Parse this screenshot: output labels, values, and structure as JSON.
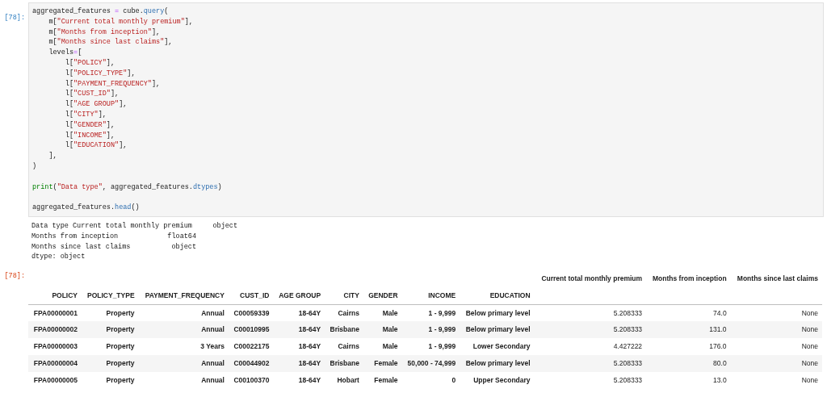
{
  "input_cell": {
    "prompt": "[78]:",
    "lines": [
      [
        {
          "kind": "plain",
          "text": "aggregated_features "
        },
        {
          "kind": "op",
          "text": "="
        },
        {
          "kind": "plain",
          "text": " cube."
        },
        {
          "kind": "method",
          "text": "query"
        },
        {
          "kind": "plain",
          "text": "("
        }
      ],
      [
        {
          "kind": "plain",
          "text": "    m["
        },
        {
          "kind": "string",
          "text": "\"Current total monthly premium\""
        },
        {
          "kind": "plain",
          "text": "],"
        }
      ],
      [
        {
          "kind": "plain",
          "text": "    m["
        },
        {
          "kind": "string",
          "text": "\"Months from inception\""
        },
        {
          "kind": "plain",
          "text": "],"
        }
      ],
      [
        {
          "kind": "plain",
          "text": "    m["
        },
        {
          "kind": "string",
          "text": "\"Months since last claims\""
        },
        {
          "kind": "plain",
          "text": "],"
        }
      ],
      [
        {
          "kind": "plain",
          "text": "    levels"
        },
        {
          "kind": "op",
          "text": "="
        },
        {
          "kind": "plain",
          "text": "["
        }
      ],
      [
        {
          "kind": "plain",
          "text": "        l["
        },
        {
          "kind": "string",
          "text": "\"POLICY\""
        },
        {
          "kind": "plain",
          "text": "],"
        }
      ],
      [
        {
          "kind": "plain",
          "text": "        l["
        },
        {
          "kind": "string",
          "text": "\"POLICY_TYPE\""
        },
        {
          "kind": "plain",
          "text": "],"
        }
      ],
      [
        {
          "kind": "plain",
          "text": "        l["
        },
        {
          "kind": "string",
          "text": "\"PAYMENT_FREQUENCY\""
        },
        {
          "kind": "plain",
          "text": "],"
        }
      ],
      [
        {
          "kind": "plain",
          "text": "        l["
        },
        {
          "kind": "string",
          "text": "\"CUST_ID\""
        },
        {
          "kind": "plain",
          "text": "],"
        }
      ],
      [
        {
          "kind": "plain",
          "text": "        l["
        },
        {
          "kind": "string",
          "text": "\"AGE GROUP\""
        },
        {
          "kind": "plain",
          "text": "],"
        }
      ],
      [
        {
          "kind": "plain",
          "text": "        l["
        },
        {
          "kind": "string",
          "text": "\"CITY\""
        },
        {
          "kind": "plain",
          "text": "],"
        }
      ],
      [
        {
          "kind": "plain",
          "text": "        l["
        },
        {
          "kind": "string",
          "text": "\"GENDER\""
        },
        {
          "kind": "plain",
          "text": "],"
        }
      ],
      [
        {
          "kind": "plain",
          "text": "        l["
        },
        {
          "kind": "string",
          "text": "\"INCOME\""
        },
        {
          "kind": "plain",
          "text": "],"
        }
      ],
      [
        {
          "kind": "plain",
          "text": "        l["
        },
        {
          "kind": "string",
          "text": "\"EDUCATION\""
        },
        {
          "kind": "plain",
          "text": "],"
        }
      ],
      [
        {
          "kind": "plain",
          "text": "    ],"
        }
      ],
      [
        {
          "kind": "plain",
          "text": ")"
        }
      ],
      [
        {
          "kind": "blank"
        }
      ],
      [
        {
          "kind": "builtin",
          "text": "print"
        },
        {
          "kind": "plain",
          "text": "("
        },
        {
          "kind": "string",
          "text": "\"Data type\""
        },
        {
          "kind": "plain",
          "text": ", aggregated_features."
        },
        {
          "kind": "method",
          "text": "dtypes"
        },
        {
          "kind": "plain",
          "text": ")"
        }
      ],
      [
        {
          "kind": "blank"
        }
      ],
      [
        {
          "kind": "plain",
          "text": "aggregated_features."
        },
        {
          "kind": "method",
          "text": "head"
        },
        {
          "kind": "plain",
          "text": "()"
        }
      ]
    ]
  },
  "stream_output": [
    "Data type Current total monthly premium     object",
    "Months from inception            float64",
    "Months since last claims          object",
    "dtype: object"
  ],
  "output_cell": {
    "prompt": "[78]:",
    "table": {
      "columns": [
        "Current total monthly premium",
        "Months from inception",
        "Months since last claims"
      ],
      "index_names": [
        "POLICY",
        "POLICY_TYPE",
        "PAYMENT_FREQUENCY",
        "CUST_ID",
        "AGE GROUP",
        "CITY",
        "GENDER",
        "INCOME",
        "EDUCATION"
      ],
      "rows": [
        {
          "index": [
            "FPA00000001",
            "Property",
            "Annual",
            "C00059339",
            "18-64Y",
            "Cairns",
            "Male",
            "1 - 9,999",
            "Below primary level"
          ],
          "values": [
            "5.208333",
            "74.0",
            "None"
          ]
        },
        {
          "index": [
            "FPA00000002",
            "Property",
            "Annual",
            "C00010995",
            "18-64Y",
            "Brisbane",
            "Male",
            "1 - 9,999",
            "Below primary level"
          ],
          "values": [
            "5.208333",
            "131.0",
            "None"
          ]
        },
        {
          "index": [
            "FPA00000003",
            "Property",
            "3 Years",
            "C00022175",
            "18-64Y",
            "Cairns",
            "Male",
            "1 - 9,999",
            "Lower Secondary"
          ],
          "values": [
            "4.427222",
            "176.0",
            "None"
          ]
        },
        {
          "index": [
            "FPA00000004",
            "Property",
            "Annual",
            "C00044902",
            "18-64Y",
            "Brisbane",
            "Female",
            "50,000 - 74,999",
            "Below primary level"
          ],
          "values": [
            "5.208333",
            "80.0",
            "None"
          ]
        },
        {
          "index": [
            "FPA00000005",
            "Property",
            "Annual",
            "C00100370",
            "18-64Y",
            "Hobart",
            "Female",
            "0",
            "Upper Secondary"
          ],
          "values": [
            "5.208333",
            "13.0",
            "None"
          ]
        }
      ]
    }
  }
}
